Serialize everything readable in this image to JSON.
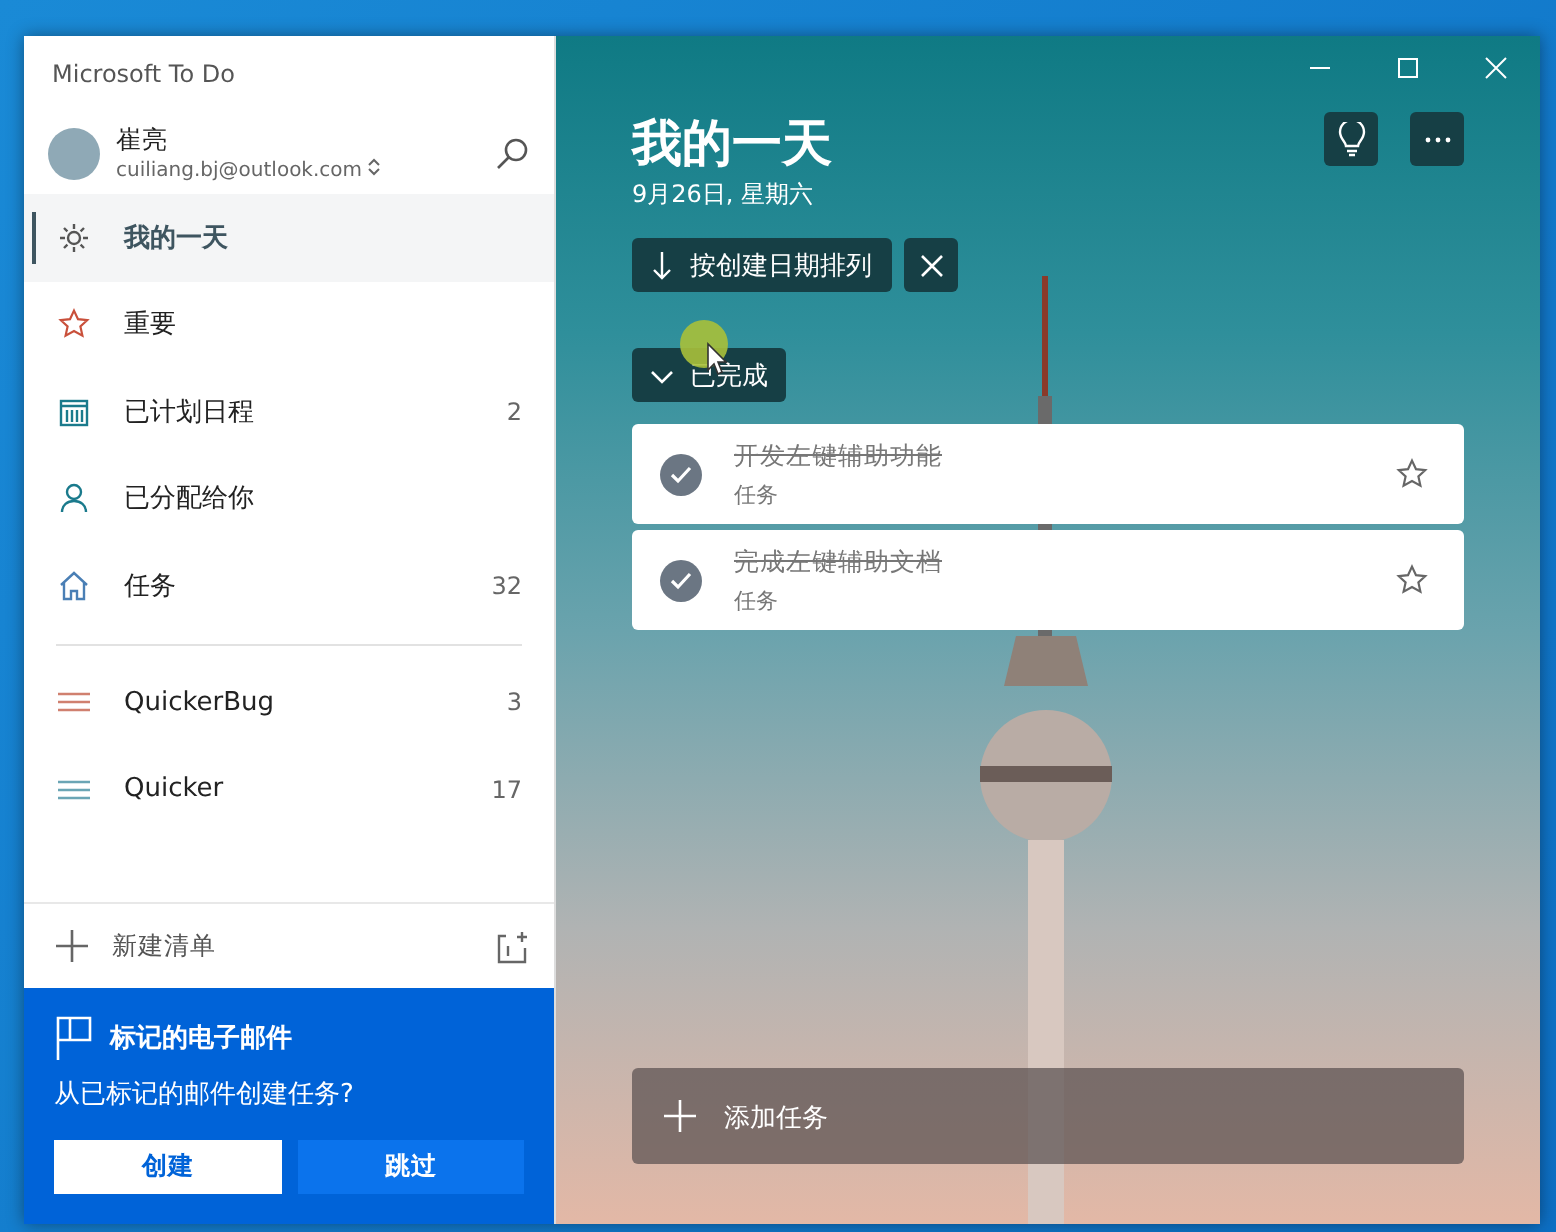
{
  "window": {
    "title": "Microsoft To Do"
  },
  "account": {
    "name": "崔亮",
    "email": "cuiliang.bj@outlook.com"
  },
  "sidebar": {
    "items": [
      {
        "kind": "sun",
        "label": "我的一天",
        "selected": true
      },
      {
        "kind": "star",
        "label": "重要",
        "selected": false
      },
      {
        "kind": "calendar",
        "label": "已计划日程",
        "count": "2",
        "selected": false
      },
      {
        "kind": "person",
        "label": "已分配给你",
        "selected": false
      },
      {
        "kind": "home",
        "label": "任务",
        "count": "32",
        "selected": false
      }
    ],
    "lists": [
      {
        "label": "QuickerBug",
        "count": "3",
        "color": "#d0806f",
        "selected": false
      },
      {
        "label": "Quicker",
        "count": "17",
        "color": "#6aa5b5",
        "selected": false
      }
    ],
    "new_list": "新建清单"
  },
  "promo": {
    "title": "标记的电子邮件",
    "text": "从已标记的邮件创建任务?",
    "buttons": [
      "创建",
      "跳过"
    ]
  },
  "main": {
    "title": "我的一天",
    "date": "9月26日, 星期六",
    "sort": "按创建日期排列",
    "completed_section": {
      "label": "已完成",
      "expanded": true
    },
    "tasks": [
      {
        "title": "开发左键辅助功能",
        "subtitle": "任务",
        "completed": true,
        "important": false
      },
      {
        "title": "完成左键辅助文档",
        "subtitle": "任务",
        "completed": true,
        "important": false
      }
    ],
    "add_task": {
      "placeholder": "添加任务"
    }
  }
}
